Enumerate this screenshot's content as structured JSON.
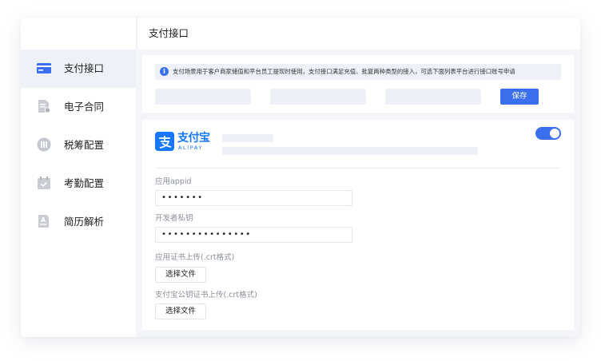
{
  "header": {
    "title": "支付接口"
  },
  "sidebar": {
    "items": [
      {
        "label": "支付接口",
        "icon": "payment-card-icon",
        "active": true
      },
      {
        "label": "电子合同",
        "icon": "contract-document-icon",
        "active": false
      },
      {
        "label": "税筹配置",
        "icon": "tax-coin-icon",
        "active": false
      },
      {
        "label": "考勤配置",
        "icon": "attendance-calendar-icon",
        "active": false
      },
      {
        "label": "简历解析",
        "icon": "resume-parse-icon",
        "active": false
      }
    ]
  },
  "notice": {
    "icon": "info-icon",
    "text": "支付场景用于客户商家储值和平台员工提现时使用，支付接口满足充值、批复两种类型的接入，可选下面列表平台进行接口账号申请"
  },
  "toolbar": {
    "save_label": "保存"
  },
  "alipay": {
    "logo_cn": "支付宝",
    "logo_en": "ALIPAY",
    "enabled": true,
    "fields": [
      {
        "label": "应用appid",
        "value": "•••••••"
      },
      {
        "label": "开发者私钥",
        "value": "•••••••••••••••"
      }
    ],
    "uploads": [
      {
        "label": "应用证书上传(.crt格式)",
        "button": "选择文件"
      },
      {
        "label": "支付宝公钥证书上传(.crt格式)",
        "button": "选择文件"
      }
    ]
  },
  "colors": {
    "accent": "#3a6ff0",
    "alipay_brand": "#1677ff",
    "active_nav_bg": "#eef1f7",
    "app_bg": "#f3f5f9"
  }
}
